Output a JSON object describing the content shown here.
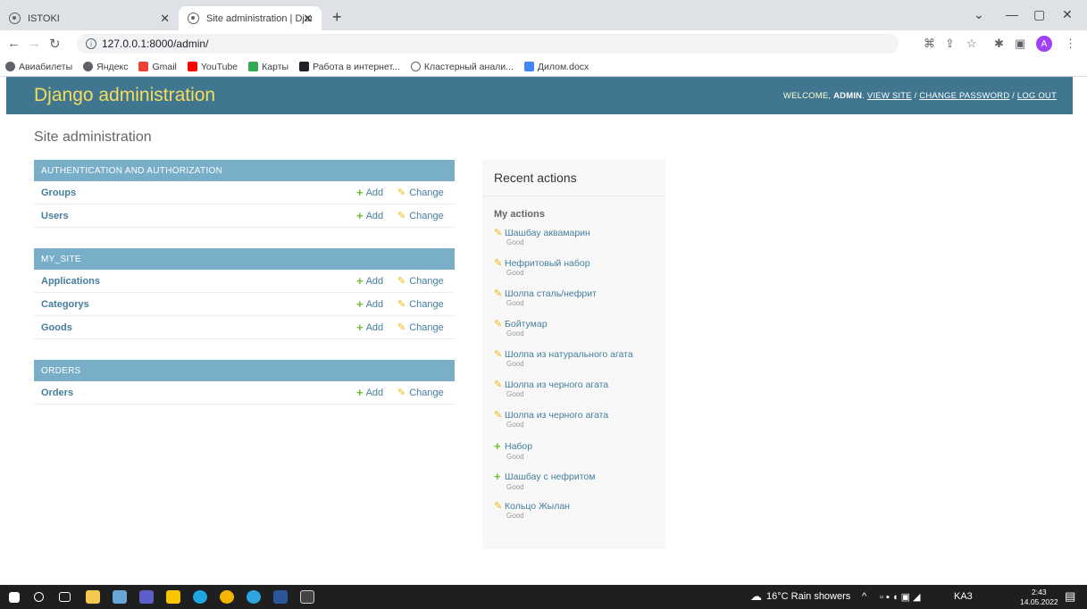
{
  "browser": {
    "tabs": [
      {
        "title": "ISTOKI",
        "close": "✕"
      },
      {
        "title": "Site administration | Django site",
        "close": "✕"
      }
    ],
    "new_tab": "+",
    "url": "127.0.0.1:8000/admin/",
    "bookmarks": [
      {
        "label": "Авиабилеты",
        "color": "#5f6368"
      },
      {
        "label": "Яндекс",
        "color": "#5f6368"
      },
      {
        "label": "Gmail",
        "color": "#ea4335"
      },
      {
        "label": "YouTube",
        "color": "#ff0000"
      },
      {
        "label": "Карты",
        "color": "#34a853"
      },
      {
        "label": "Работа в интернет...",
        "color": "#202124"
      },
      {
        "label": "Кластерный анали...",
        "color": "#5f6368"
      },
      {
        "label": "Дилом.docx",
        "color": "#4285f4"
      }
    ],
    "avatar_letter": "A"
  },
  "header": {
    "brand": "Django administration",
    "welcome": "Welcome,",
    "user": "admin",
    "view_site": "View site",
    "sep": "/",
    "change_password": "Change password",
    "log_out": "Log out"
  },
  "page": {
    "title": "Site administration"
  },
  "modules": [
    {
      "caption": "Authentication and Authorization",
      "rows": [
        {
          "name": "Groups",
          "add": "Add",
          "change": "Change"
        },
        {
          "name": "Users",
          "add": "Add",
          "change": "Change"
        }
      ]
    },
    {
      "caption": "My_site",
      "rows": [
        {
          "name": "Applications",
          "add": "Add",
          "change": "Change"
        },
        {
          "name": "Categorys",
          "add": "Add",
          "change": "Change"
        },
        {
          "name": "Goods",
          "add": "Add",
          "change": "Change"
        }
      ]
    },
    {
      "caption": "Orders",
      "rows": [
        {
          "name": "Orders",
          "add": "Add",
          "change": "Change"
        }
      ]
    }
  ],
  "recent": {
    "title": "Recent actions",
    "subtitle": "My actions",
    "items": [
      {
        "label": "Шашбау аквамарин",
        "type": "Good",
        "action": "change"
      },
      {
        "label": "Нефритовый набор",
        "type": "Good",
        "action": "change"
      },
      {
        "label": "Шолпа сталь/нефрит",
        "type": "Good",
        "action": "change"
      },
      {
        "label": "Бойтумар",
        "type": "Good",
        "action": "change"
      },
      {
        "label": "Шолпа из натурального агата",
        "type": "Good",
        "action": "change"
      },
      {
        "label": "Шолпа из черного агата",
        "type": "Good",
        "action": "change"
      },
      {
        "label": "Шолпа из черного агата",
        "type": "Good",
        "action": "change"
      },
      {
        "label": "Набор",
        "type": "Good",
        "action": "add"
      },
      {
        "label": "Шашбау с нефритом",
        "type": "Good",
        "action": "add"
      },
      {
        "label": "Кольцо Жылан",
        "type": "Good",
        "action": "change"
      }
    ]
  },
  "taskbar": {
    "weather": "16°C  Rain showers",
    "lang": "KA3",
    "time": "2:43",
    "date": "14.05.2022"
  },
  "colors": {
    "header": "#417690",
    "brand": "#f5dd5d",
    "caption": "#79aec8",
    "link": "#447e9b"
  }
}
